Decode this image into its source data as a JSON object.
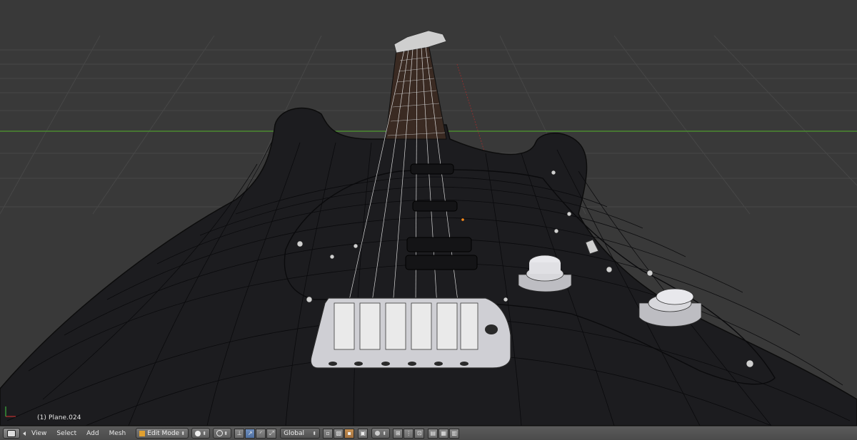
{
  "viewport": {
    "object_label": "(1) Plane.024",
    "colors": {
      "background": "#393939",
      "grid": "#4a4a4a",
      "x_axis": "#4e9a2e",
      "body": "#1c1c1f",
      "wire": "#0a0a0a",
      "chrome": "#dcdcdc"
    }
  },
  "header": {
    "editor_icon": "3d-view-icon",
    "menus": [
      "View",
      "Select",
      "Add",
      "Mesh"
    ],
    "mode": "Edit Mode",
    "orientation": "Global"
  }
}
